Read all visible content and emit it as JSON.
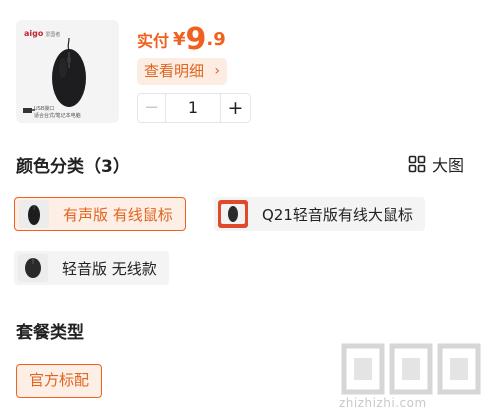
{
  "product": {
    "brand": "aigo",
    "brand_sub": "爱国者",
    "image_caption_line1": "USB接口",
    "image_caption_line2": "适合台式/笔记本电脑",
    "price_label": "实付",
    "currency": "¥",
    "price_integer": "9",
    "price_decimal": ".9",
    "detail_label": "查看明细",
    "quantity": "1",
    "minus": "−",
    "plus": "+"
  },
  "color_section": {
    "title": "颜色分类（3）",
    "view_toggle_label": "大图",
    "options": [
      {
        "label": "有声版 有线鼠标",
        "selected": true
      },
      {
        "label": "Q21轻音版有线大鼠标",
        "selected": false
      },
      {
        "label": "轻音版 无线款",
        "selected": false
      }
    ]
  },
  "package_section": {
    "title": "套餐类型",
    "options": [
      {
        "label": "官方标配",
        "selected": true
      }
    ]
  },
  "watermark": {
    "text": "zhizhizhi.com"
  },
  "colors": {
    "accent": "#f0611f",
    "accent_bg": "#fdeee6",
    "chip_bg": "#f4f4f4",
    "q21_thumb": "#e04a2a"
  },
  "icons": {
    "view_toggle": "grid-icon",
    "detail_chevron": "chevron-right-icon"
  }
}
